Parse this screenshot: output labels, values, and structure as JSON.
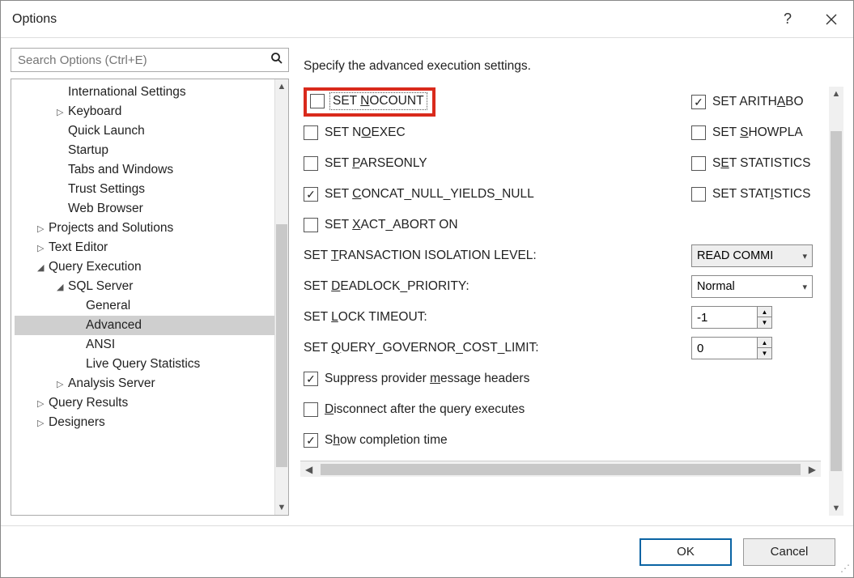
{
  "window": {
    "title": "Options"
  },
  "search": {
    "placeholder": "Search Options (Ctrl+E)"
  },
  "tree": {
    "items": [
      {
        "label": "International Settings",
        "indent": 2,
        "exp": ""
      },
      {
        "label": "Keyboard",
        "indent": 2,
        "exp": "▷"
      },
      {
        "label": "Quick Launch",
        "indent": 2,
        "exp": ""
      },
      {
        "label": "Startup",
        "indent": 2,
        "exp": ""
      },
      {
        "label": "Tabs and Windows",
        "indent": 2,
        "exp": ""
      },
      {
        "label": "Trust Settings",
        "indent": 2,
        "exp": ""
      },
      {
        "label": "Web Browser",
        "indent": 2,
        "exp": ""
      },
      {
        "label": "Projects and Solutions",
        "indent": 1,
        "exp": "▷"
      },
      {
        "label": "Text Editor",
        "indent": 1,
        "exp": "▷"
      },
      {
        "label": "Query Execution",
        "indent": 1,
        "exp": "◢"
      },
      {
        "label": "SQL Server",
        "indent": 2,
        "exp": "◢"
      },
      {
        "label": "General",
        "indent": 3,
        "exp": ""
      },
      {
        "label": "Advanced",
        "indent": 3,
        "exp": "",
        "selected": true
      },
      {
        "label": "ANSI",
        "indent": 3,
        "exp": ""
      },
      {
        "label": "Live Query Statistics",
        "indent": 3,
        "exp": ""
      },
      {
        "label": "Analysis Server",
        "indent": 2,
        "exp": "▷"
      },
      {
        "label": "Query Results",
        "indent": 1,
        "exp": "▷"
      },
      {
        "label": "Designers",
        "indent": 1,
        "exp": "▷"
      }
    ]
  },
  "description": "Specify the advanced execution settings.",
  "options": {
    "left_checks": [
      {
        "key": "nocount",
        "pre": "SET ",
        "u": "N",
        "post": "OCOUNT",
        "checked": false,
        "highlight": true,
        "dotted": true
      },
      {
        "key": "noexec",
        "pre": "SET N",
        "u": "O",
        "post": "EXEC",
        "checked": false
      },
      {
        "key": "parseonly",
        "pre": "SET ",
        "u": "P",
        "post": "ARSEONLY",
        "checked": false
      },
      {
        "key": "concatnull",
        "pre": "SET ",
        "u": "C",
        "post": "ONCAT_NULL_YIELDS_NULL",
        "checked": true
      },
      {
        "key": "xactabort",
        "pre": "SET ",
        "u": "X",
        "post": "ACT_ABORT ON",
        "checked": false
      }
    ],
    "right_checks": [
      {
        "key": "arithabort",
        "pre": "SET ARITH",
        "u": "A",
        "post": "BO",
        "checked": true
      },
      {
        "key": "showplan",
        "pre": "SET ",
        "u": "S",
        "post": "HOWPLA",
        "checked": false
      },
      {
        "key": "stats1",
        "pre": "S",
        "u": "E",
        "post": "T STATISTICS",
        "checked": false
      },
      {
        "key": "stats2",
        "pre": "SET STAT",
        "u": "I",
        "post": "STICS",
        "checked": false
      }
    ],
    "value_rows": [
      {
        "key": "isolation",
        "pre": "SET ",
        "u": "T",
        "post": "RANSACTION ISOLATION LEVEL:",
        "type": "select",
        "value": "READ COMMI",
        "bg": "grey"
      },
      {
        "key": "deadlock",
        "pre": "SET ",
        "u": "D",
        "post": "EADLOCK_PRIORITY:",
        "type": "select",
        "value": "Normal",
        "bg": "white"
      },
      {
        "key": "locktimeout",
        "pre": "SET ",
        "u": "L",
        "post": "OCK TIMEOUT:",
        "type": "spinner",
        "value": "-1"
      },
      {
        "key": "querygov",
        "pre": "SET ",
        "u": "Q",
        "post": "UERY_GOVERNOR_COST_LIMIT:",
        "type": "spinner",
        "value": "0"
      }
    ],
    "bottom_checks": [
      {
        "key": "suppress",
        "pre": "Suppress provider ",
        "u": "m",
        "post": "essage headers",
        "checked": true
      },
      {
        "key": "disconnect",
        "pre": "",
        "u": "D",
        "post": "isconnect after the query executes",
        "checked": false
      },
      {
        "key": "showtime",
        "pre": "S",
        "u": "h",
        "post": "ow completion time",
        "checked": true
      }
    ]
  },
  "footer": {
    "ok": "OK",
    "cancel": "Cancel"
  }
}
